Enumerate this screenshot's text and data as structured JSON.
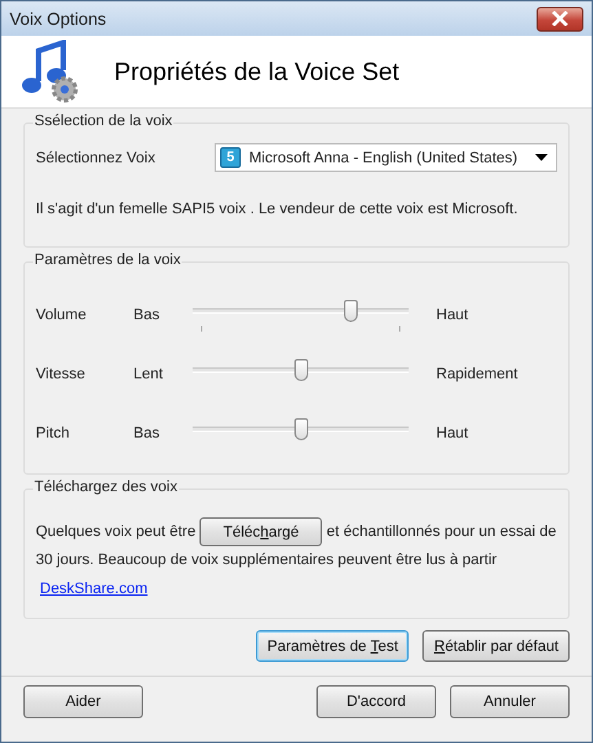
{
  "window": {
    "title": "Voix Options"
  },
  "header": {
    "title": "Propriétés de la Voice Set"
  },
  "voice_selection": {
    "legend": "Ssélection de la voix",
    "label": "Sélectionnez Voix",
    "badge": "5",
    "value": "Microsoft Anna - English (United States)",
    "description": "Il s'agit d'un femelle SAPI5 voix . Le vendeur de cette voix est Microsoft."
  },
  "voice_parameters": {
    "legend": "Paramètres de la voix",
    "sliders": [
      {
        "name": "Volume",
        "low": "Bas",
        "high": "Haut",
        "level": 0.73,
        "ticks": true
      },
      {
        "name": "Vitesse",
        "low": "Lent",
        "high": "Rapidement",
        "level": 0.5,
        "ticks": false
      },
      {
        "name": "Pitch",
        "low": "Bas",
        "high": "Haut",
        "level": 0.5,
        "ticks": false
      }
    ]
  },
  "download": {
    "legend": "Téléchargez des voix",
    "text_before": "Quelques voix peut être",
    "button": {
      "before": "Téléc",
      "accel": "h",
      "after": "argé"
    },
    "text_after": "et échantillonnés pour un essai de 30 jours. Beaucoup de voix supplémentaires peuvent être lus à partir",
    "link": "DeskShare.com"
  },
  "action_buttons": [
    {
      "before": "Paramètres de ",
      "accel": "T",
      "after": "est",
      "focused": true
    },
    {
      "accel": "R",
      "after": "établir par défaut",
      "focused": false
    }
  ],
  "footer_buttons": {
    "left": [
      "Aider"
    ],
    "right": [
      "D'accord",
      "Annuler"
    ]
  }
}
